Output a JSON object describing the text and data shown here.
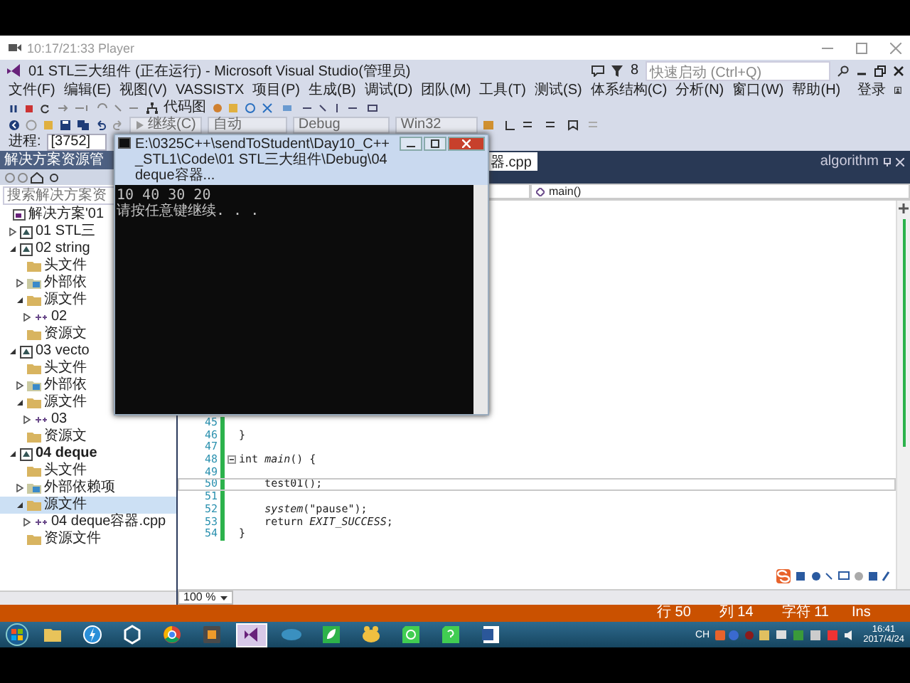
{
  "player": {
    "title": "10:17/21:33 Player"
  },
  "vs": {
    "title": "01 STL三大组件 (正在运行) - Microsoft Visual Studio(管理员)",
    "notification_count": "8",
    "quick_launch": {
      "placeholder": "快速启动 (Ctrl+Q)"
    },
    "menu": [
      "文件(F)",
      "编辑(E)",
      "视图(V)",
      "VASSISTX",
      "项目(P)",
      "生成(B)",
      "调试(D)",
      "团队(M)",
      "工具(T)",
      "测试(S)",
      "体系结构(C)",
      "分析(N)",
      "窗口(W)",
      "帮助(H)"
    ],
    "sign_in": "登录",
    "toolbar_1": {
      "code_map": "代码图"
    },
    "toolbar_2": {
      "continue": "继续(C)",
      "frame": "自动",
      "config": "Debug",
      "platform": "Win32"
    },
    "process_bar": {
      "label": "进程:",
      "value": "[3752]"
    }
  },
  "solution_explorer": {
    "title": "解决方案资源管",
    "search": {
      "placeholder": "搜索解决方案资"
    },
    "tree": [
      {
        "label": "解决方案'01",
        "kind": "solution",
        "selected": false,
        "children": [
          {
            "label": "01 STL三",
            "kind": "project",
            "expanded": false,
            "selected": false,
            "bold": false
          },
          {
            "label": "02 string",
            "kind": "project",
            "expanded": true,
            "selected": false,
            "bold": false,
            "children": [
              {
                "label": "头文件",
                "kind": "folder",
                "selected": false
              },
              {
                "label": "外部依",
                "kind": "deps",
                "expanded": false,
                "selected": false
              },
              {
                "label": "源文件",
                "kind": "folder",
                "expanded": true,
                "selected": false,
                "children": [
                  {
                    "label": "02",
                    "kind": "file",
                    "expanded": false,
                    "selected": false
                  }
                ]
              },
              {
                "label": "资源文",
                "kind": "folder",
                "selected": false
              }
            ]
          },
          {
            "label": "03 vecto",
            "kind": "project",
            "expanded": true,
            "selected": false,
            "bold": false,
            "children": [
              {
                "label": "头文件",
                "kind": "folder",
                "selected": false
              },
              {
                "label": "外部依",
                "kind": "deps",
                "expanded": false,
                "selected": false
              },
              {
                "label": "源文件",
                "kind": "folder",
                "expanded": true,
                "selected": false,
                "children": [
                  {
                    "label": "03",
                    "kind": "file",
                    "expanded": false,
                    "selected": false
                  }
                ]
              },
              {
                "label": "资源文",
                "kind": "folder",
                "selected": false
              }
            ]
          },
          {
            "label": "04 deque",
            "kind": "project",
            "expanded": true,
            "selected": false,
            "bold": true,
            "children": [
              {
                "label": "头文件",
                "kind": "folder",
                "selected": false
              },
              {
                "label": "外部依赖项",
                "kind": "deps",
                "expanded": false,
                "selected": false
              },
              {
                "label": "源文件",
                "kind": "folder",
                "expanded": true,
                "selected": true,
                "children": [
                  {
                    "label": "04 deque容器.cpp",
                    "kind": "file",
                    "expanded": false,
                    "selected": false
                  }
                ]
              },
              {
                "label": "资源文件",
                "kind": "folder",
                "selected": false
              }
            ]
          }
        ]
      }
    ]
  },
  "editor": {
    "tab": "器.cpp",
    "pinned_tab": "algorithm",
    "nav": {
      "member": "main()"
    },
    "lines": [
      {
        "number": "45",
        "fold": false,
        "current": false
      },
      {
        "number": "46",
        "code": "}",
        "fold": false,
        "current": false
      },
      {
        "number": "47",
        "fold": false,
        "current": false
      },
      {
        "number": "48",
        "code": "int *main*() {",
        "fold": true,
        "current": false
      },
      {
        "number": "49",
        "fold": false,
        "current": false
      },
      {
        "number": "50",
        "code": "    test01();",
        "fold": false,
        "current": true
      },
      {
        "number": "51",
        "fold": false,
        "current": false
      },
      {
        "number": "52",
        "code": "    *system*(\"pause\");",
        "fold": false,
        "current": false
      },
      {
        "number": "53",
        "code": "    return *EXIT_SUCCESS*;",
        "fold": false,
        "current": false
      },
      {
        "number": "54",
        "code": "}",
        "fold": false,
        "current": false
      }
    ],
    "zoom": "100 %"
  },
  "console": {
    "title": "E:\\0325C++\\sendToStudent\\Day10_C++_STL1\\Code\\01 STL三大组件\\Debug\\04 deque容器...",
    "output": [
      "10 40 30 20",
      "请按任意键继续. . ."
    ]
  },
  "status_bar": [
    "行 50",
    "列 14",
    "字符 11",
    "Ins"
  ],
  "taskbar": {
    "apps": [
      {
        "kind": "folder",
        "selected": false
      },
      {
        "kind": "lightning",
        "selected": false
      },
      {
        "kind": "cube",
        "selected": false
      },
      {
        "kind": "ring",
        "selected": false
      },
      {
        "kind": "tile",
        "selected": false
      },
      {
        "kind": "ribbon",
        "selected": true
      },
      {
        "kind": "disc",
        "selected": false
      },
      {
        "kind": "leaf",
        "selected": false
      },
      {
        "kind": "blob",
        "selected": false
      },
      {
        "kind": "qt",
        "selected": false
      },
      {
        "kind": "qthelp",
        "selected": false
      },
      {
        "kind": "doc",
        "selected": false
      }
    ],
    "language": "CH",
    "time": "16:41",
    "date": "2017/4/24"
  }
}
